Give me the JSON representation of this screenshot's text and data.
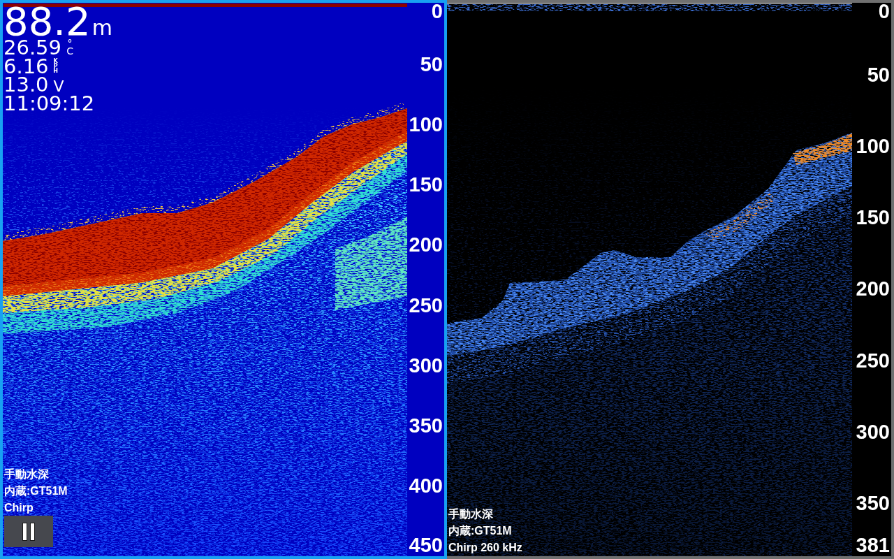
{
  "panes": [
    {
      "kind": "rainbow",
      "selected": true,
      "readouts": [
        {
          "kind": "depth",
          "value": "88.2",
          "unit": "m"
        },
        {
          "kind": "temperature",
          "value": "26.59",
          "unit": "°C"
        },
        {
          "kind": "speed",
          "value": "6.16",
          "unit": "KPH"
        },
        {
          "kind": "voltage",
          "value": "13.0",
          "unit": "V"
        },
        {
          "kind": "time",
          "value": "11:09:12"
        }
      ],
      "depth_scale": [
        "0",
        "50",
        "100",
        "150",
        "200",
        "250",
        "300",
        "350",
        "400",
        "450"
      ],
      "info_lines": [
        "手動水深",
        "内蔵:GT51M",
        "Chirp"
      ],
      "pause_button": {
        "paused": false
      }
    },
    {
      "kind": "ice_blue",
      "selected": false,
      "depth_scale": [
        "0",
        "50",
        "100",
        "150",
        "200",
        "250",
        "300",
        "350",
        "381"
      ],
      "info_lines": [
        "手動水深",
        "内蔵:GT51M",
        "Chirp 260 kHz"
      ]
    }
  ]
}
